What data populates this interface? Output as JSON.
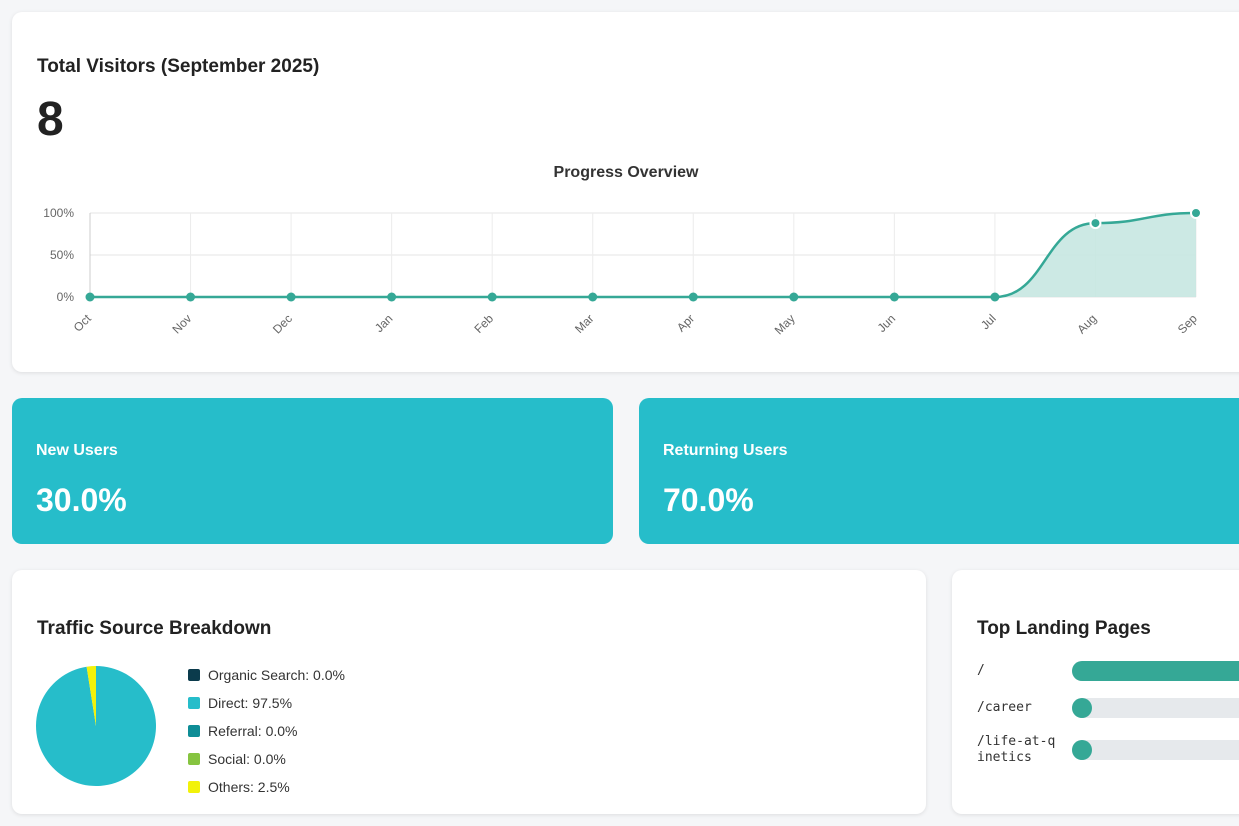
{
  "visitors": {
    "title": "Total Visitors (September 2025)",
    "value": "8"
  },
  "chart_data": {
    "type": "area",
    "title": "Progress Overview",
    "categories": [
      "Oct",
      "Nov",
      "Dec",
      "Jan",
      "Feb",
      "Mar",
      "Apr",
      "May",
      "Jun",
      "Jul",
      "Aug",
      "Sep"
    ],
    "y_ticks": [
      "0%",
      "50%",
      "100%"
    ],
    "ylim": [
      0,
      100
    ],
    "series": [
      {
        "values": [
          0,
          0,
          0,
          0,
          0,
          0,
          0,
          0,
          0,
          0,
          88,
          100
        ]
      }
    ],
    "grid": true,
    "colors": {
      "line": "#35a896",
      "fill": "#c6e7e1"
    }
  },
  "new_users": {
    "label": "New Users",
    "value": "30.0%"
  },
  "returning_users": {
    "label": "Returning Users",
    "value": "70.0%"
  },
  "traffic": {
    "title": "Traffic Source Breakdown",
    "sources": [
      {
        "label": "Organic Search: 0.0%",
        "value": 0.0,
        "color": "#0b3b4c"
      },
      {
        "label": "Direct: 97.5%",
        "value": 97.5,
        "color": "#26bdca"
      },
      {
        "label": "Referral: 0.0%",
        "value": 0.0,
        "color": "#0e8d96"
      },
      {
        "label": "Social: 0.0%",
        "value": 0.0,
        "color": "#86c440"
      },
      {
        "label": "Others: 2.5%",
        "value": 2.5,
        "color": "#f2f20a"
      }
    ]
  },
  "landing_pages": {
    "title": "Top Landing Pages",
    "items": [
      {
        "path": "/",
        "share": 1.0
      },
      {
        "path": "/career",
        "share": 0.0
      },
      {
        "path": "/life-at-qinetics",
        "share": 0.0
      }
    ]
  }
}
